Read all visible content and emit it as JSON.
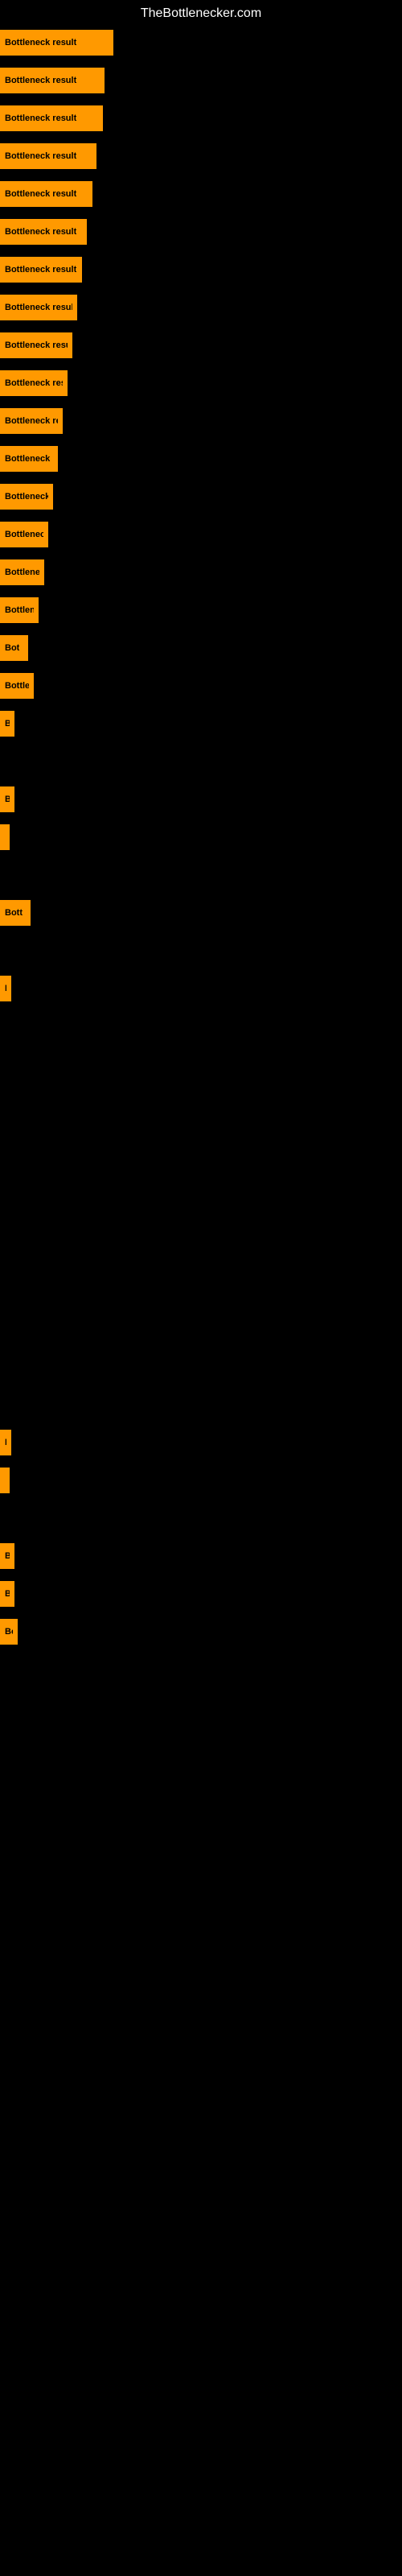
{
  "site": {
    "title": "TheBottlenecker.com"
  },
  "bars": [
    {
      "label": "Bottleneck result",
      "width": 141
    },
    {
      "label": "Bottleneck result",
      "width": 130
    },
    {
      "label": "Bottleneck result",
      "width": 128
    },
    {
      "label": "Bottleneck result",
      "width": 120
    },
    {
      "label": "Bottleneck result",
      "width": 115
    },
    {
      "label": "Bottleneck result",
      "width": 108
    },
    {
      "label": "Bottleneck result",
      "width": 102
    },
    {
      "label": "Bottleneck result",
      "width": 96
    },
    {
      "label": "Bottleneck result",
      "width": 90
    },
    {
      "label": "Bottleneck result",
      "width": 84
    },
    {
      "label": "Bottleneck result",
      "width": 78
    },
    {
      "label": "Bottleneck res",
      "width": 72
    },
    {
      "label": "Bottleneck re",
      "width": 66
    },
    {
      "label": "Bottleneck re",
      "width": 60
    },
    {
      "label": "Bottleneck r",
      "width": 55
    },
    {
      "label": "Bottlene",
      "width": 48
    },
    {
      "label": "Bot",
      "width": 35
    },
    {
      "label": "Bottle",
      "width": 42
    },
    {
      "label": "B",
      "width": 18
    },
    {
      "label": "",
      "width": 0
    },
    {
      "label": "B",
      "width": 18
    },
    {
      "label": "|",
      "width": 5
    },
    {
      "label": "",
      "width": 0
    },
    {
      "label": "Bott",
      "width": 38
    },
    {
      "label": "",
      "width": 0
    },
    {
      "label": "E",
      "width": 14
    },
    {
      "label": "",
      "width": 0
    },
    {
      "label": "",
      "width": 0
    },
    {
      "label": "",
      "width": 0
    },
    {
      "label": "",
      "width": 0
    },
    {
      "label": "",
      "width": 0
    },
    {
      "label": "",
      "width": 0
    },
    {
      "label": "",
      "width": 0
    },
    {
      "label": "",
      "width": 0
    },
    {
      "label": "",
      "width": 0
    },
    {
      "label": "",
      "width": 0
    },
    {
      "label": "",
      "width": 0
    },
    {
      "label": "E",
      "width": 14
    },
    {
      "label": "|",
      "width": 5
    },
    {
      "label": "",
      "width": 0
    },
    {
      "label": "B",
      "width": 18
    },
    {
      "label": "B",
      "width": 18
    },
    {
      "label": "Bo",
      "width": 22
    }
  ]
}
